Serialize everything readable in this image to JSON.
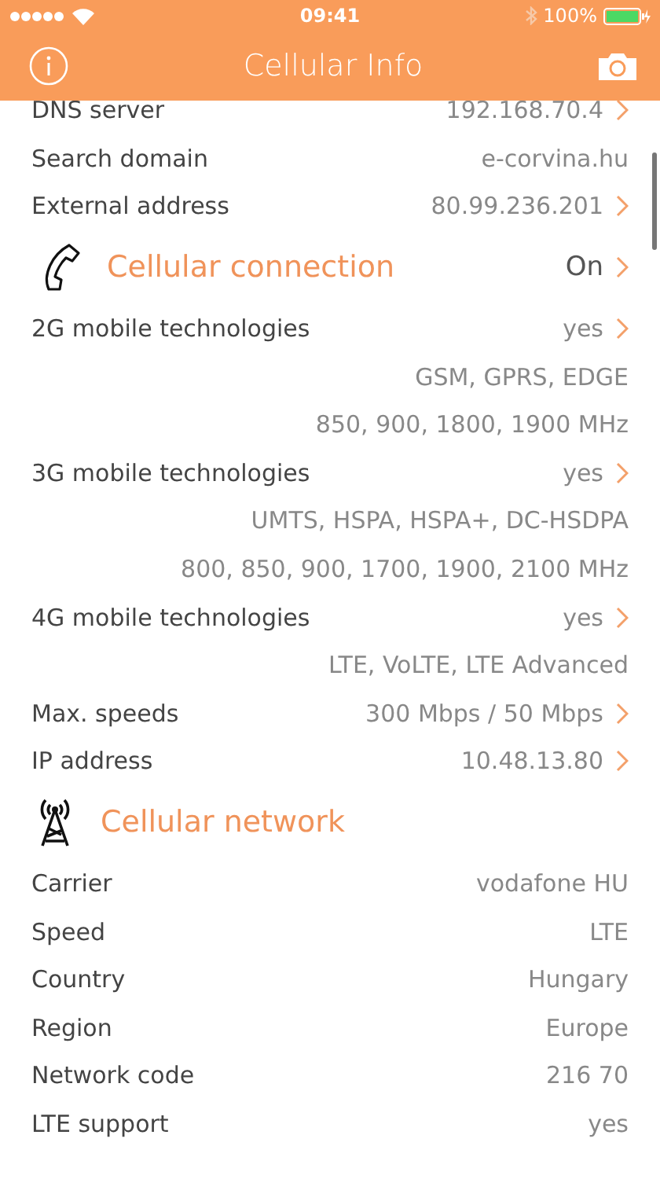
{
  "status_bar": {
    "time": "09:41",
    "battery": "100%"
  },
  "nav_bar": {
    "title": "Cellular Info"
  },
  "items": [
    {
      "kind": "row",
      "label": "DNS server",
      "value": "192.168.70.4",
      "chevron": true
    },
    {
      "kind": "row",
      "label": "Search domain",
      "value": "e-corvina.hu",
      "chevron": false
    },
    {
      "kind": "row",
      "label": "External address",
      "value": "80.99.236.201",
      "chevron": true
    },
    {
      "kind": "header",
      "title": "Cellular connection",
      "value": "On",
      "chevron": true
    },
    {
      "kind": "row",
      "label": "2G mobile technologies",
      "value": "yes",
      "chevron": true
    },
    {
      "kind": "detail",
      "value": "GSM, GPRS, EDGE"
    },
    {
      "kind": "detail",
      "value": "850, 900, 1800, 1900 MHz"
    },
    {
      "kind": "row",
      "label": "3G mobile technologies",
      "value": "yes",
      "chevron": true
    },
    {
      "kind": "detail",
      "value": "UMTS, HSPA, HSPA+, DC-HSDPA"
    },
    {
      "kind": "detail",
      "value": "800, 850, 900, 1700, 1900, 2100 MHz"
    },
    {
      "kind": "row",
      "label": "4G mobile technologies",
      "value": "yes",
      "chevron": true
    },
    {
      "kind": "detail",
      "value": "LTE, VoLTE, LTE Advanced"
    },
    {
      "kind": "row",
      "label": "Max. speeds",
      "value": "300 Mbps / 50 Mbps",
      "chevron": true
    },
    {
      "kind": "row",
      "label": "IP address",
      "value": "10.48.13.80",
      "chevron": true
    },
    {
      "kind": "header",
      "title": "Cellular network"
    },
    {
      "kind": "row",
      "label": "Carrier",
      "value": "vodafone HU",
      "chevron": false
    },
    {
      "kind": "row",
      "label": "Speed",
      "value": "LTE",
      "chevron": false
    },
    {
      "kind": "row",
      "label": "Country",
      "value": "Hungary",
      "chevron": false
    },
    {
      "kind": "row",
      "label": "Region",
      "value": "Europe",
      "chevron": false
    },
    {
      "kind": "row",
      "label": "Network code",
      "value": "216 70",
      "chevron": false
    },
    {
      "kind": "row",
      "label": "LTE support",
      "value": "yes",
      "chevron": false
    }
  ]
}
